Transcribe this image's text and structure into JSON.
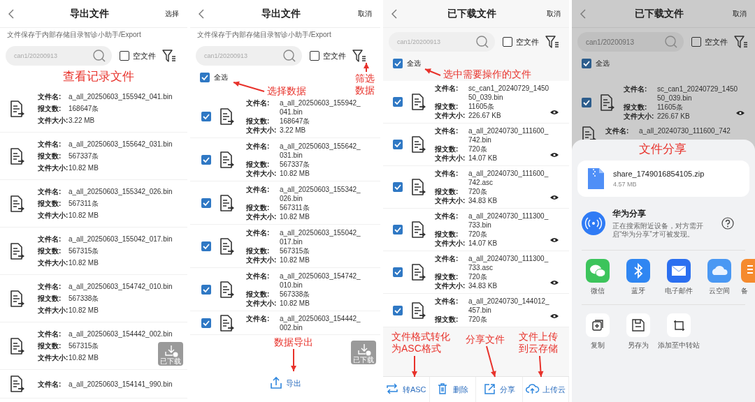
{
  "panels": [
    {
      "kind": "browse",
      "header": {
        "title": "导出文件",
        "action": "选择"
      },
      "path_note": "文件保存于内部存储目录智诊小助手/Export",
      "search": {
        "placeholder": "can1/20200913"
      },
      "empty_file": {
        "label": "空文件",
        "checked": false
      },
      "files": [
        {
          "fields": [
            {
              "label": "文件名:",
              "value": "a_all_20250603_155942_041.bin"
            },
            {
              "label": "报文数:",
              "value": "168647条"
            },
            {
              "label": "文件大小:",
              "value": "3.22 MB"
            }
          ]
        },
        {
          "fields": [
            {
              "label": "文件名:",
              "value": "a_all_20250603_155642_031.bin"
            },
            {
              "label": "报文数:",
              "value": "567337条"
            },
            {
              "label": "文件大小:",
              "value": "10.82 MB"
            }
          ]
        },
        {
          "fields": [
            {
              "label": "文件名:",
              "value": "a_all_20250603_155342_026.bin"
            },
            {
              "label": "报文数:",
              "value": "567311条"
            },
            {
              "label": "文件大小:",
              "value": "10.82 MB"
            }
          ]
        },
        {
          "fields": [
            {
              "label": "文件名:",
              "value": "a_all_20250603_155042_017.bin"
            },
            {
              "label": "报文数:",
              "value": "567315条"
            },
            {
              "label": "文件大小:",
              "value": "10.82 MB"
            }
          ]
        },
        {
          "fields": [
            {
              "label": "文件名:",
              "value": "a_all_20250603_154742_010.bin"
            },
            {
              "label": "报文数:",
              "value": "567338条"
            },
            {
              "label": "文件大小:",
              "value": "10.82 MB"
            }
          ]
        },
        {
          "fields": [
            {
              "label": "文件名:",
              "value": "a_all_20250603_154442_002.bin"
            },
            {
              "label": "报文数:",
              "value": "567315条"
            },
            {
              "label": "文件大小:",
              "value": "10.82 MB"
            }
          ]
        },
        {
          "fields": [
            {
              "label": "文件名:",
              "value": "a_all_20250603_154141_990.bin"
            }
          ]
        }
      ],
      "floating_button": {
        "label": "已下载"
      },
      "annotations": [
        {
          "text": "查看记录文件",
          "kind": "list"
        }
      ]
    },
    {
      "kind": "select",
      "header": {
        "title": "导出文件",
        "action": "取消"
      },
      "path_note": "文件保存于内部存储目录智诊小助手/Export",
      "search": {
        "placeholder": "can1/20200913"
      },
      "empty_file": {
        "label": "空文件",
        "checked": false
      },
      "select_all": {
        "label": "全选",
        "checked": true
      },
      "files": [
        {
          "checked": true,
          "fields": [
            {
              "label": "文件名:",
              "value": "a_all_20250603_155942_041.bin"
            },
            {
              "label": "报文数:",
              "value": "168647条"
            },
            {
              "label": "文件大小:",
              "value": "3.22 MB"
            }
          ]
        },
        {
          "checked": true,
          "fields": [
            {
              "label": "文件名:",
              "value": "a_all_20250603_155642_031.bin"
            },
            {
              "label": "报文数:",
              "value": "567337条"
            },
            {
              "label": "文件大小:",
              "value": "10.82 MB"
            }
          ]
        },
        {
          "checked": true,
          "fields": [
            {
              "label": "文件名:",
              "value": "a_all_20250603_155342_026.bin"
            },
            {
              "label": "报文数:",
              "value": "567311条"
            },
            {
              "label": "文件大小:",
              "value": "10.82 MB"
            }
          ]
        },
        {
          "checked": true,
          "fields": [
            {
              "label": "文件名:",
              "value": "a_all_20250603_155042_017.bin"
            },
            {
              "label": "报文数:",
              "value": "567315条"
            },
            {
              "label": "文件大小:",
              "value": "10.82 MB"
            }
          ]
        },
        {
          "checked": true,
          "fields": [
            {
              "label": "文件名:",
              "value": "a_all_20250603_154742_010.bin"
            },
            {
              "label": "报文数:",
              "value": "567338条"
            },
            {
              "label": "文件大小:",
              "value": "10.82 MB"
            }
          ]
        },
        {
          "checked": true,
          "fields": [
            {
              "label": "文件名:",
              "value": "a_all_20250603_154442_002.bin"
            }
          ]
        }
      ],
      "floating_button": {
        "label": "已下载"
      },
      "bottom_actions": [
        {
          "kind": "export",
          "label": "导出"
        }
      ],
      "annotations": [
        {
          "text": "选择数据",
          "kind": "select_all"
        },
        {
          "text": "筛选数据",
          "kind": "filter"
        },
        {
          "text": "数据导出",
          "kind": "export"
        }
      ]
    },
    {
      "kind": "downloaded",
      "header": {
        "title": "已下载文件",
        "action": "取消"
      },
      "search": {
        "placeholder": "can1/20200913"
      },
      "empty_file": {
        "label": "空文件",
        "checked": false
      },
      "select_all": {
        "label": "全选",
        "checked": true
      },
      "files": [
        {
          "checked": true,
          "preview": true,
          "fields": [
            {
              "label": "文件名:",
              "value": "sc_can1_20240729_145050_039.bin"
            },
            {
              "label": "报文数:",
              "value": "11605条"
            },
            {
              "label": "文件大小:",
              "value": "226.67 KB"
            }
          ]
        },
        {
          "checked": true,
          "preview": true,
          "fields": [
            {
              "label": "文件名:",
              "value": "a_all_20240730_111600_742.bin"
            },
            {
              "label": "报文数:",
              "value": "720条"
            },
            {
              "label": "文件大小:",
              "value": "14.07 KB"
            }
          ]
        },
        {
          "checked": true,
          "preview": true,
          "fields": [
            {
              "label": "文件名:",
              "value": "a_all_20240730_111600_742.asc"
            },
            {
              "label": "报文数:",
              "value": "720条"
            },
            {
              "label": "文件大小:",
              "value": "34.83 KB"
            }
          ]
        },
        {
          "checked": true,
          "preview": true,
          "fields": [
            {
              "label": "文件名:",
              "value": "a_all_20240730_111300_733.bin"
            },
            {
              "label": "报文数:",
              "value": "720条"
            },
            {
              "label": "文件大小:",
              "value": "14.07 KB"
            }
          ]
        },
        {
          "checked": true,
          "preview": true,
          "fields": [
            {
              "label": "文件名:",
              "value": "a_all_20240730_111300_733.asc"
            },
            {
              "label": "报文数:",
              "value": "720条"
            },
            {
              "label": "文件大小:",
              "value": "34.83 KB"
            }
          ]
        },
        {
          "checked": true,
          "preview": true,
          "fields": [
            {
              "label": "文件名:",
              "value": "a_all_20240730_144012_457.bin"
            },
            {
              "label": "报文数:",
              "value": "720条"
            }
          ]
        }
      ],
      "bottom_actions": [
        {
          "kind": "convert",
          "label": "转ASC"
        },
        {
          "kind": "delete",
          "label": "删除"
        },
        {
          "kind": "share",
          "label": "分享"
        },
        {
          "kind": "upload",
          "label": "上传云"
        }
      ],
      "annotations": [
        {
          "text": "选中需要操作的文件",
          "kind": "select_all"
        },
        {
          "text": "文件格式转化为ASC格式",
          "kind": "convert"
        },
        {
          "text": "分享文件",
          "kind": "share"
        },
        {
          "text": "文件上传到云存储",
          "kind": "upload"
        }
      ]
    },
    {
      "kind": "share",
      "dimmed": true,
      "header": {
        "title": "已下载文件",
        "action": "取消"
      },
      "search": {
        "placeholder": "can1/20200913"
      },
      "empty_file": {
        "label": "空文件",
        "checked": false
      },
      "select_all": {
        "label": "全选",
        "checked": true
      },
      "files": [
        {
          "checked": true,
          "preview": true,
          "fields": [
            {
              "label": "文件名:",
              "value": "sc_can1_20240729_145050_039.bin"
            },
            {
              "label": "报文数:",
              "value": "11605条"
            },
            {
              "label": "文件大小:",
              "value": "226.67 KB"
            }
          ]
        },
        {
          "fields": [
            {
              "label": "文件名:",
              "value": "a_all_20240730_111600_742"
            }
          ]
        }
      ],
      "share_sheet": {
        "file": {
          "name": "share_1749016854105.zip",
          "size": "4.57 MB"
        },
        "nearby": {
          "title": "华为分享",
          "description": "正在搜索附近设备，对方需开启“华为分享”才可被发现。"
        },
        "apps": [
          {
            "kind": "wechat",
            "label": "微信"
          },
          {
            "kind": "bluetooth",
            "label": "蓝牙"
          },
          {
            "kind": "email",
            "label": "电子邮件"
          },
          {
            "kind": "cloud",
            "label": "云空间"
          },
          {
            "kind": "other",
            "label": "备"
          }
        ],
        "actions": [
          {
            "kind": "copy",
            "label": "复制"
          },
          {
            "kind": "save",
            "label": "另存为"
          },
          {
            "kind": "transfer",
            "label": "添加至中转站"
          }
        ]
      },
      "annotations": [
        {
          "text": "文件分享",
          "kind": "share_sheet"
        }
      ]
    }
  ]
}
